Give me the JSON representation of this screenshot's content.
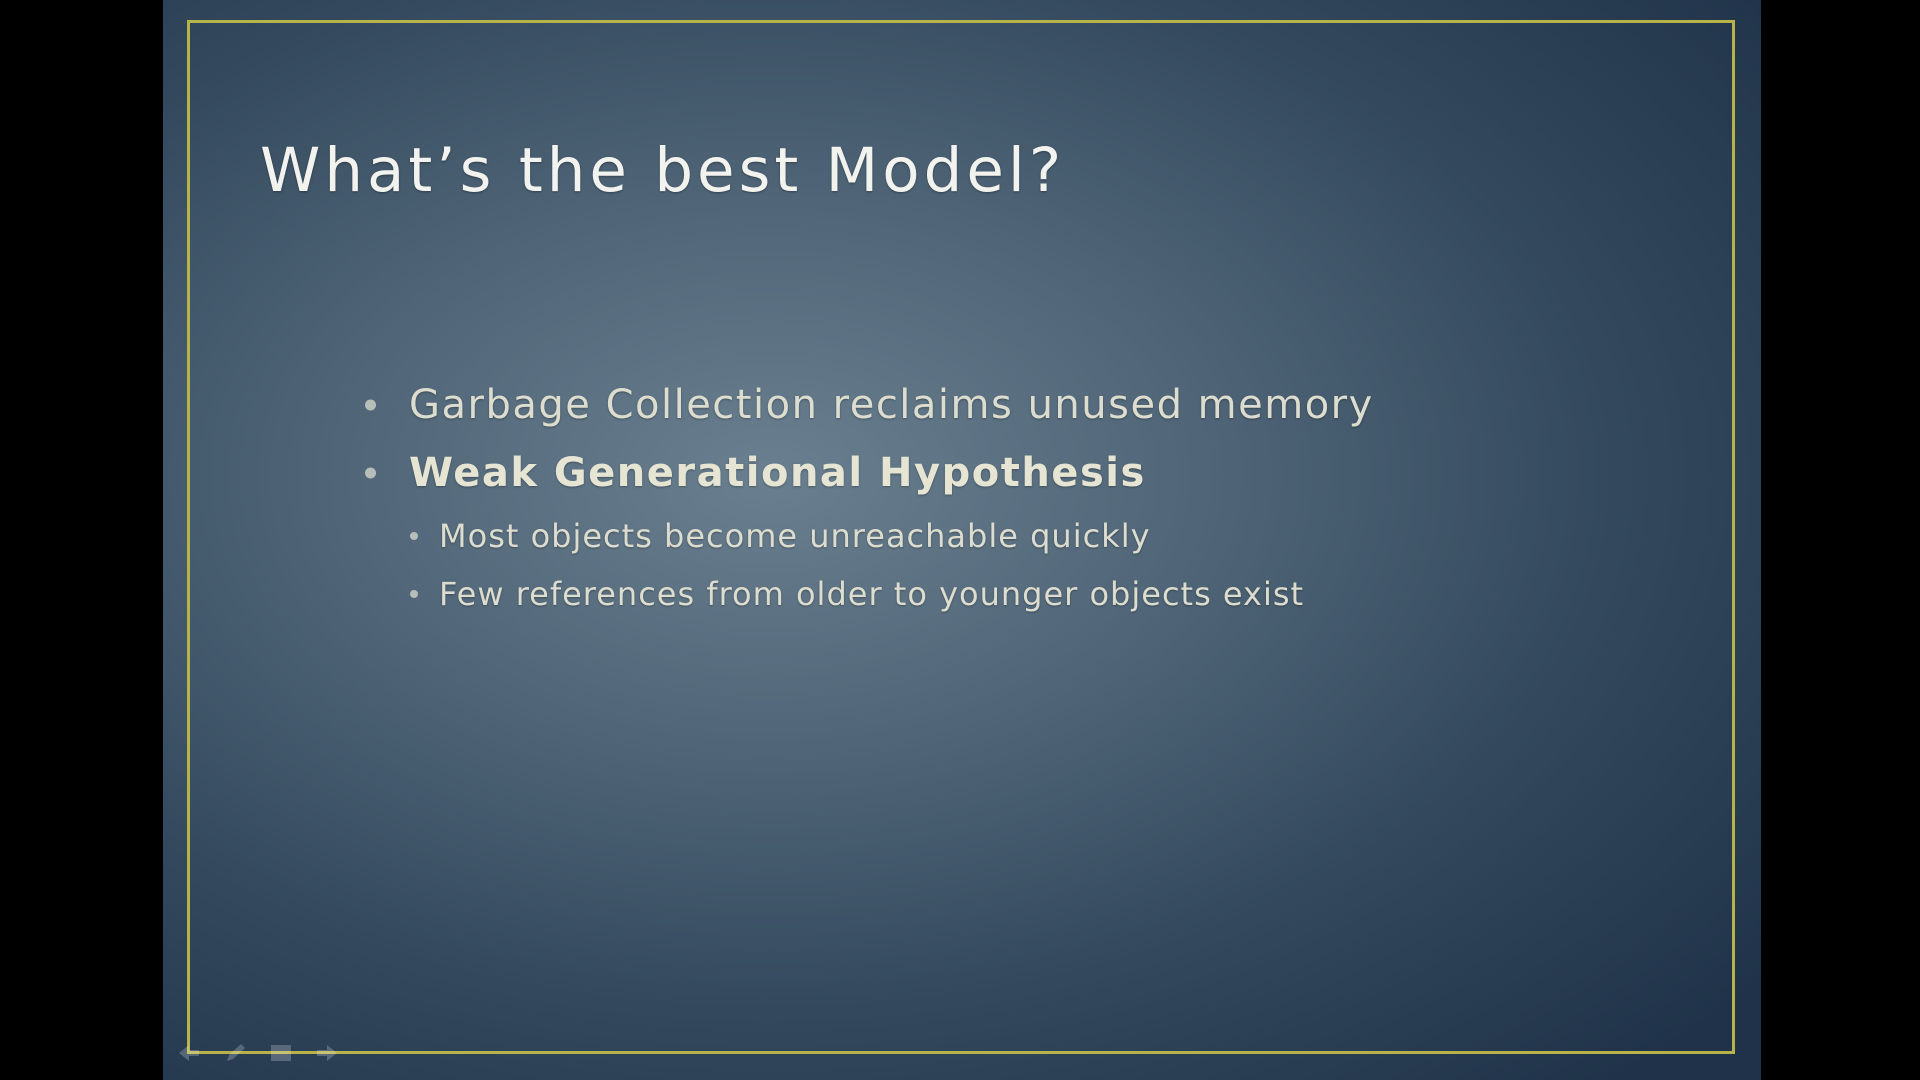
{
  "slide": {
    "title": "What’s the best Model?",
    "bullets": [
      {
        "level": 1,
        "bold": false,
        "text": "Garbage Collection reclaims unused memory"
      },
      {
        "level": 1,
        "bold": true,
        "text": "Weak Generational Hypothesis"
      },
      {
        "level": 2,
        "bold": false,
        "text": "Most objects become unreachable quickly"
      },
      {
        "level": 2,
        "bold": false,
        "text": "Few references from older to younger objects exist"
      }
    ]
  },
  "presenter_tools": {
    "icons": [
      "previous-arrow-icon",
      "pen-icon",
      "slides-grid-icon",
      "next-arrow-icon"
    ]
  },
  "colors": {
    "frame_border": "#b8b24a",
    "title_text": "#f2f2ee",
    "bullet_text": "#dcdccf",
    "background_center": "#6a8090",
    "background_edge": "#1f3249"
  }
}
